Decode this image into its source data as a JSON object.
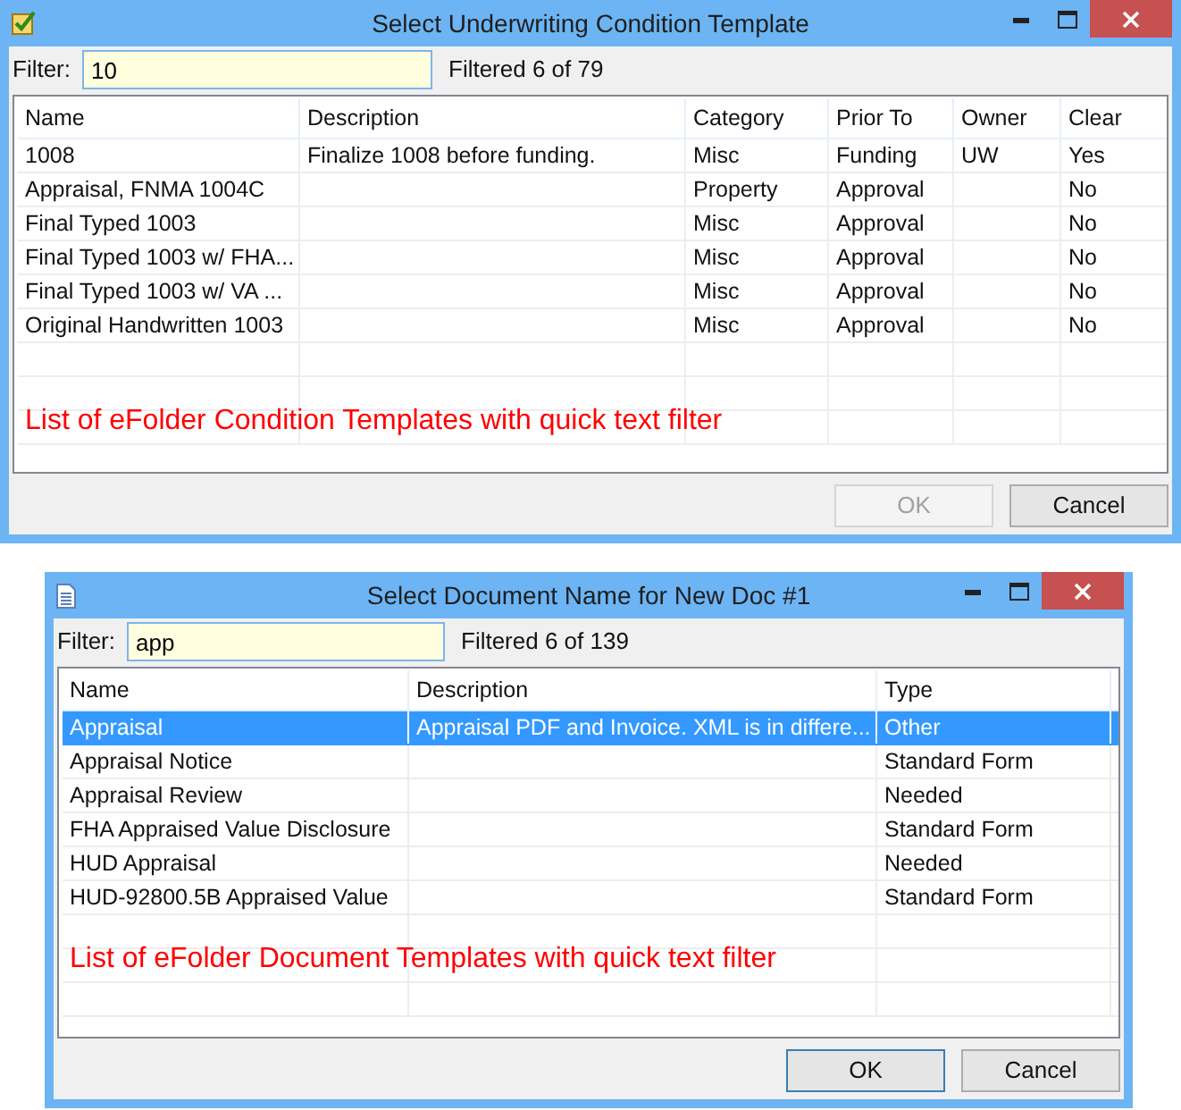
{
  "dialogs": [
    {
      "title": "Select Underwriting Condition Template",
      "filter": {
        "label": "Filter:",
        "value": "10"
      },
      "count": "Filtered 6 of 79",
      "columns": [
        "Name",
        "Description",
        "Category",
        "Prior To",
        "Owner",
        "Clear"
      ],
      "rows": [
        {
          "selected": false,
          "cells": [
            "1008",
            "Finalize 1008 before funding.",
            "Misc",
            "Funding",
            "UW",
            "Yes"
          ]
        },
        {
          "selected": false,
          "cells": [
            "Appraisal, FNMA 1004C",
            "",
            "Property",
            "Approval",
            "",
            "No"
          ]
        },
        {
          "selected": false,
          "cells": [
            "Final Typed 1003",
            "",
            "Misc",
            "Approval",
            "",
            "No"
          ]
        },
        {
          "selected": false,
          "cells": [
            "Final Typed 1003 w/ FHA...",
            "",
            "Misc",
            "Approval",
            "",
            "No"
          ]
        },
        {
          "selected": false,
          "cells": [
            "Final Typed 1003 w/ VA ...",
            "",
            "Misc",
            "Approval",
            "",
            "No"
          ]
        },
        {
          "selected": false,
          "cells": [
            "Original Handwritten 1003",
            "",
            "Misc",
            "Approval",
            "",
            "No"
          ]
        }
      ],
      "annotation": "List of eFolder Condition Templates with quick text filter",
      "buttons": [
        {
          "label": "OK",
          "disabled": true,
          "default": false
        },
        {
          "label": "Cancel",
          "disabled": false,
          "default": false
        }
      ]
    },
    {
      "title": "Select Document Name for New Doc #1",
      "filter": {
        "label": "Filter:",
        "value": "app"
      },
      "count": "Filtered 6 of 139",
      "columns": [
        "Name",
        "Description",
        "Type"
      ],
      "rows": [
        {
          "selected": true,
          "cells": [
            "Appraisal",
            "Appraisal PDF and Invoice.  XML is in differe...",
            "Other"
          ]
        },
        {
          "selected": false,
          "cells": [
            "Appraisal Notice",
            "",
            "Standard Form"
          ]
        },
        {
          "selected": false,
          "cells": [
            "Appraisal Review",
            "",
            "Needed"
          ]
        },
        {
          "selected": false,
          "cells": [
            "FHA Appraised Value Disclosure",
            "",
            "Standard Form"
          ]
        },
        {
          "selected": false,
          "cells": [
            "HUD Appraisal",
            "",
            "Needed"
          ]
        },
        {
          "selected": false,
          "cells": [
            "HUD-92800.5B Appraised Value",
            "",
            "Standard Form"
          ]
        }
      ],
      "annotation": "List of eFolder Document Templates with quick text filter",
      "buttons": [
        {
          "label": "OK",
          "disabled": false,
          "default": true
        },
        {
          "label": "Cancel",
          "disabled": false,
          "default": false
        }
      ]
    }
  ]
}
